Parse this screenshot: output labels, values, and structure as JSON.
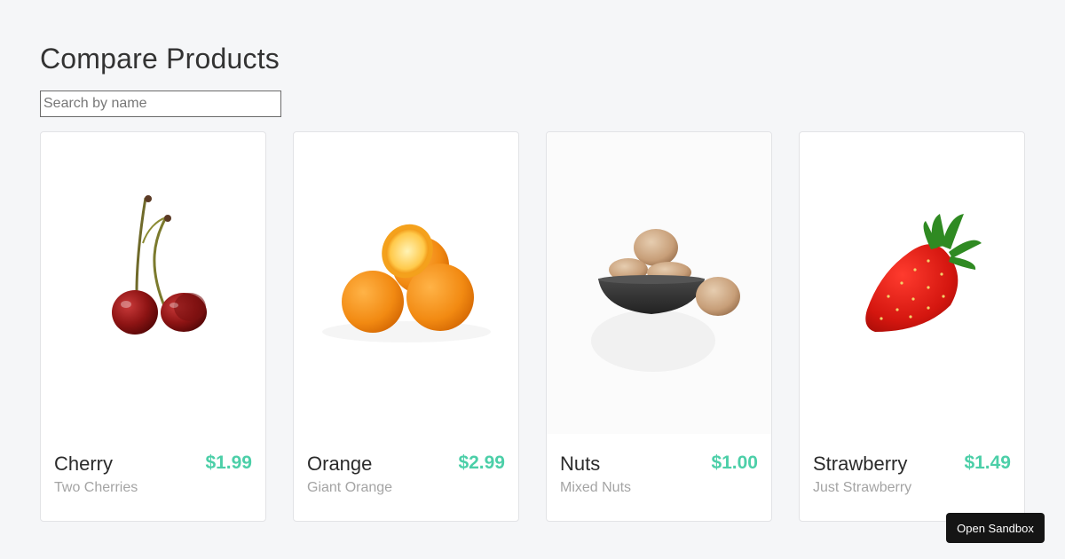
{
  "page": {
    "title": "Compare Products"
  },
  "search": {
    "placeholder": "Search by name",
    "value": ""
  },
  "products": [
    {
      "name": "Cherry",
      "price": "$1.99",
      "description": "Two Cherries",
      "image": "cherry-image"
    },
    {
      "name": "Orange",
      "price": "$2.99",
      "description": "Giant Orange",
      "image": "orange-image"
    },
    {
      "name": "Nuts",
      "price": "$1.00",
      "description": "Mixed Nuts",
      "image": "nuts-image"
    },
    {
      "name": "Strawberry",
      "price": "$1.49",
      "description": "Just Strawberry",
      "image": "strawberry-image"
    }
  ],
  "colors": {
    "background": "#f5f6f8",
    "price": "#4ccfa8",
    "description": "#a4a4a4",
    "sandbox_button": "#151515"
  },
  "sandbox": {
    "label": "Open Sandbox"
  }
}
